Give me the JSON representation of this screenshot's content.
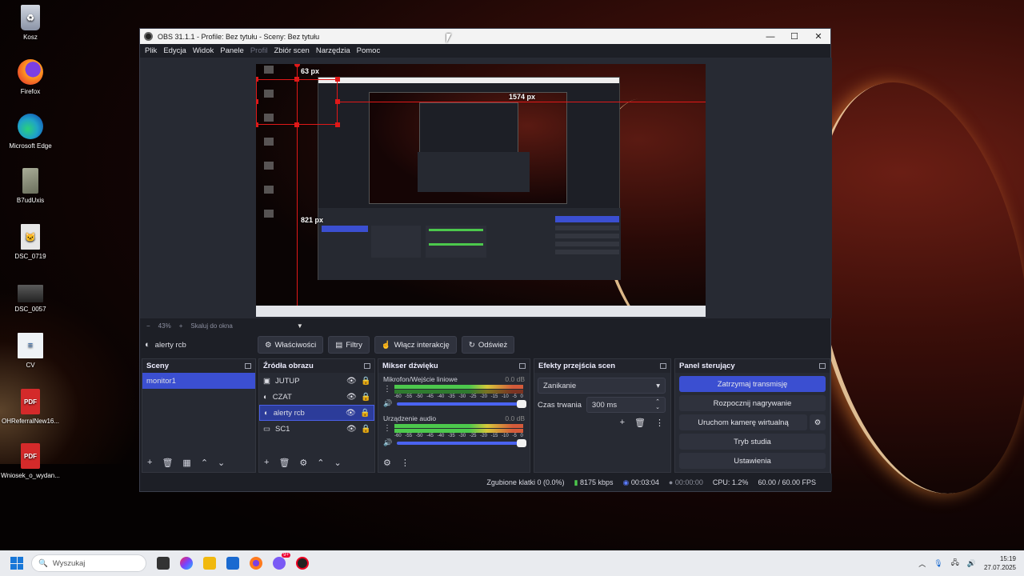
{
  "desktop": {
    "icons": [
      {
        "label": "Kosz",
        "icon": "recycle-bin-icon",
        "color": "#9aa4b5"
      },
      {
        "label": "Firefox",
        "icon": "firefox-icon",
        "color": "#e8662a"
      },
      {
        "label": "Microsoft Edge",
        "icon": "edge-icon",
        "color": "#1fa2c8"
      },
      {
        "label": "B7udUxis",
        "icon": "file-icon",
        "color": "#8a8f7a"
      },
      {
        "label": "DSC_0719",
        "icon": "image-icon",
        "color": "#b8b8b8"
      },
      {
        "label": "DSC_0057",
        "icon": "image-icon",
        "color": "#3b3b3b"
      },
      {
        "label": "CV",
        "icon": "document-icon",
        "color": "#e8eef4"
      },
      {
        "label": "OHReferralNew16...",
        "icon": "pdf-icon",
        "color": "#d42a2a"
      },
      {
        "label": "Wniosek_o_wydan...",
        "icon": "pdf-icon",
        "color": "#d42a2a"
      }
    ],
    "pdf_badge": "PDF"
  },
  "window": {
    "title": "OBS 31.1.1 - Profile: Bez tytułu - Sceny: Bez tytułu",
    "menu": [
      "Plik",
      "Edycja",
      "Widok",
      "Panele",
      "Profil",
      "Zbiór scen",
      "Narzędzia",
      "Pomoc"
    ],
    "preview_labels": {
      "top": "63 px",
      "right": "1574 px",
      "left": "821 px"
    },
    "zoom": {
      "minus": "−",
      "percent": "43%",
      "plus": "+",
      "fit": "Skaluj do okna"
    },
    "source_bar": {
      "selected_source": "alerty rcb",
      "properties": "Właściwości",
      "filters": "Filtry",
      "interact": "Włącz interakcję",
      "refresh": "Odśwież"
    }
  },
  "scenes": {
    "title": "Sceny",
    "items": [
      "monitor1"
    ]
  },
  "sources": {
    "title": "Źródła obrazu",
    "items": [
      {
        "name": "JUTUP",
        "icon": "window-capture-icon"
      },
      {
        "name": "CZAT",
        "icon": "browser-source-icon"
      },
      {
        "name": "alerty rcb",
        "icon": "browser-source-icon"
      },
      {
        "name": "SC1",
        "icon": "display-capture-icon"
      }
    ]
  },
  "mixer": {
    "title": "Mikser dźwięku",
    "channels": [
      {
        "name": "Mikrofon/Wejście liniowe",
        "db": "0.0 dB",
        "level": 0.33
      },
      {
        "name": "Urządzenie audio",
        "db": "0.0 dB",
        "level": 0.85
      }
    ],
    "ticks": [
      "-60",
      "-55",
      "-50",
      "-45",
      "-40",
      "-35",
      "-30",
      "-25",
      "-20",
      "-15",
      "-10",
      "-5",
      "0"
    ]
  },
  "transitions": {
    "title": "Efekty przejścia scen",
    "selected": "Zanikanie",
    "duration_label": "Czas trwania",
    "duration": "300 ms"
  },
  "controls": {
    "title": "Panel sterujący",
    "stop_stream": "Zatrzymaj transmisję",
    "start_recording": "Rozpocznij nagrywanie",
    "virtual_cam": "Uruchom kamerę wirtualną",
    "studio": "Tryb studia",
    "settings": "Ustawienia"
  },
  "status": {
    "dropped": "Zgubione klatki 0 (0.0%)",
    "bitrate": "8175 kbps",
    "stream_time": "00:03:04",
    "rec_time": "00:00:00",
    "cpu": "CPU: 1.2%",
    "fps": "60.00 / 60.00 FPS"
  },
  "taskbar": {
    "search_placeholder": "Wyszukaj",
    "time": "15:19",
    "date": "27.07.2025",
    "discord_badge": "9+"
  },
  "accent": "#3b4fd1"
}
